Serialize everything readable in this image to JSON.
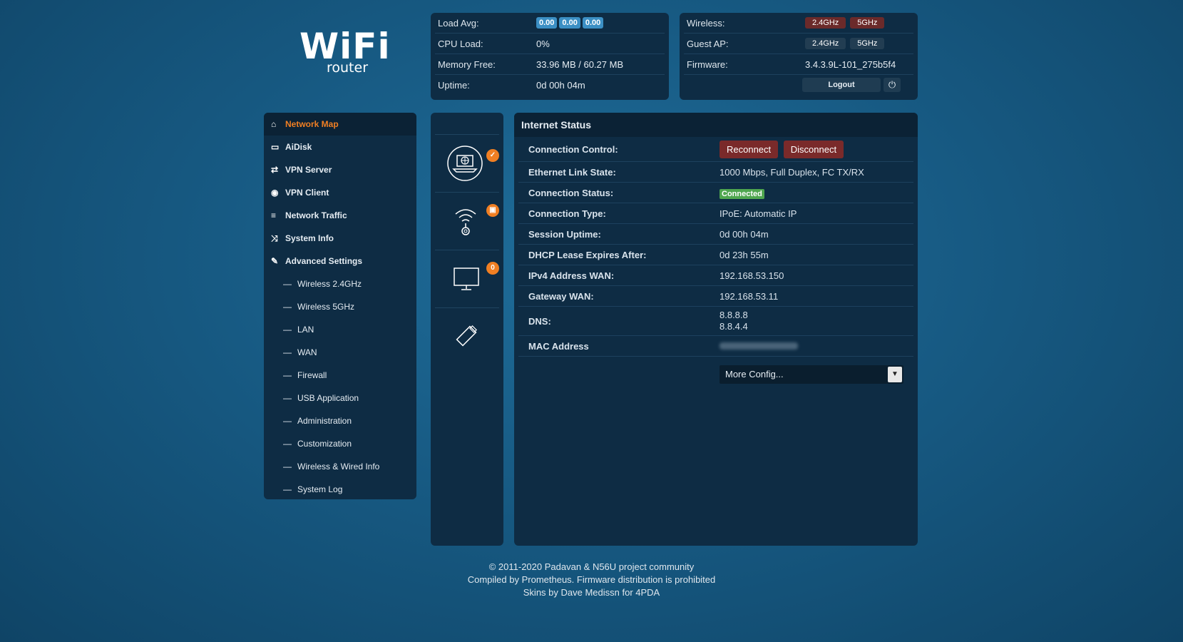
{
  "logo": {
    "big": "WiFi",
    "small": "router"
  },
  "stats": {
    "load_avg_label": "Load Avg:",
    "load_avg": [
      "0.00",
      "0.00",
      "0.00"
    ],
    "cpu_label": "CPU Load:",
    "cpu": "0%",
    "mem_label": "Memory Free:",
    "mem": "33.96 MB / 60.27 MB",
    "uptime_label": "Uptime:",
    "uptime": "0d 00h 04m"
  },
  "wstat": {
    "wireless_label": "Wireless:",
    "guest_label": "Guest AP:",
    "band_24": "2.4GHz",
    "band_5": "5GHz",
    "firmware_label": "Firmware:",
    "firmware": "3.4.3.9L-101_275b5f4",
    "logout": "Logout"
  },
  "sidebar": {
    "items": [
      {
        "label": "Network Map",
        "icon": "home-icon"
      },
      {
        "label": "AiDisk",
        "icon": "disk-icon"
      },
      {
        "label": "VPN Server",
        "icon": "retweet-icon"
      },
      {
        "label": "VPN Client",
        "icon": "globe-icon"
      },
      {
        "label": "Network Traffic",
        "icon": "list-icon"
      },
      {
        "label": "System Info",
        "icon": "random-icon"
      },
      {
        "label": "Advanced Settings",
        "icon": "wrench-icon"
      }
    ],
    "sub": [
      "Wireless 2.4GHz",
      "Wireless 5GHz",
      "LAN",
      "WAN",
      "Firewall",
      "USB Application",
      "Administration",
      "Customization",
      "Wireless & Wired Info",
      "System Log"
    ],
    "dash": "—"
  },
  "iconcol": {
    "clients_count": "0"
  },
  "main": {
    "title": "Internet Status",
    "control_label": "Connection Control:",
    "reconnect": "Reconnect",
    "disconnect": "Disconnect",
    "eth_label": "Ethernet Link State:",
    "eth": "1000 Mbps, Full Duplex, FC TX/RX",
    "status_label": "Connection Status:",
    "status": "Connected",
    "type_label": "Connection Type:",
    "type": "IPoE: Automatic IP",
    "session_label": "Session Uptime:",
    "session": "0d 00h 04m",
    "dhcp_label": "DHCP Lease Expires After:",
    "dhcp": "0d 23h 55m",
    "ipv4_label": "IPv4 Address WAN:",
    "ipv4": "192.168.53.150",
    "gw_label": "Gateway WAN:",
    "gw": "192.168.53.11",
    "dns_label": "DNS:",
    "dns1": "8.8.8.8",
    "dns2": "8.8.4.4",
    "mac_label": "MAC Address",
    "more": "More Config..."
  },
  "footer": {
    "line1": "© 2011-2020 Padavan & N56U project community",
    "line2": "Compiled by Prometheus. Firmware distribution is prohibited",
    "line3": "Skins by Dave Medissn for 4PDA"
  },
  "colors": {
    "accent": "#f07f23",
    "panel": "#0e2c44",
    "danger": "#7a2a2a",
    "ok": "#4fa64f"
  }
}
